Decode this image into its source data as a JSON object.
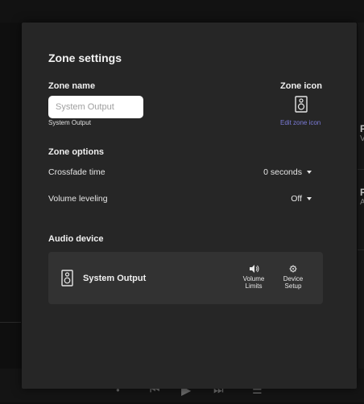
{
  "modal": {
    "title": "Zone settings",
    "zone_name_label": "Zone name",
    "zone_name_placeholder": "System Output",
    "zone_name_hint": "System Output",
    "zone_icon_label": "Zone icon",
    "edit_zone_icon": "Edit zone icon",
    "zone_options_label": "Zone options",
    "options": [
      {
        "label": "Crossfade time",
        "value": "0 seconds"
      },
      {
        "label": "Volume leveling",
        "value": "Off"
      }
    ],
    "audio_device_label": "Audio device",
    "device": {
      "name": "System Output",
      "volume_limits_line1": "Volume",
      "volume_limits_line2": "Limits",
      "device_setup_line1": "Device",
      "device_setup_line2": "Setup"
    }
  },
  "background": {
    "right_letters": [
      "P",
      "V",
      "P",
      "A"
    ]
  },
  "icons": {
    "zone_icon": "speaker-icon",
    "device_icon": "speaker-icon",
    "volume_icon": "volume-icon",
    "setup_icon": "gear-icon"
  }
}
